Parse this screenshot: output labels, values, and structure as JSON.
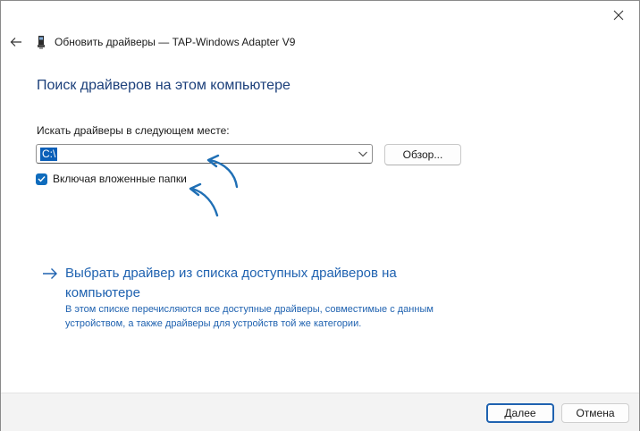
{
  "header": {
    "title": "Обновить драйверы — TAP-Windows Adapter V9",
    "back_icon": "back-arrow-icon",
    "device_icon": "network-adapter-icon"
  },
  "main": {
    "heading": "Поиск драйверов на этом компьютере",
    "search_label": "Искать драйверы в следующем месте:",
    "path_value": "C:\\",
    "browse_label": "Обзор...",
    "include_subfolders_label": "Включая вложенные папки",
    "include_subfolders_checked": true,
    "pick_link": "Выбрать драйвер из списка доступных драйверов на компьютере",
    "pick_description": "В этом списке перечисляются все доступные драйверы, совместимые с данным устройством, а также драйверы для устройств той же категории."
  },
  "footer": {
    "next_label": "Далее",
    "cancel_label": "Отмена"
  },
  "colors": {
    "accent": "#1f62b0",
    "heading": "#1b3f7a",
    "annotation_arrow": "#1f6fb5",
    "footer_bg": "#f3f3f3"
  }
}
